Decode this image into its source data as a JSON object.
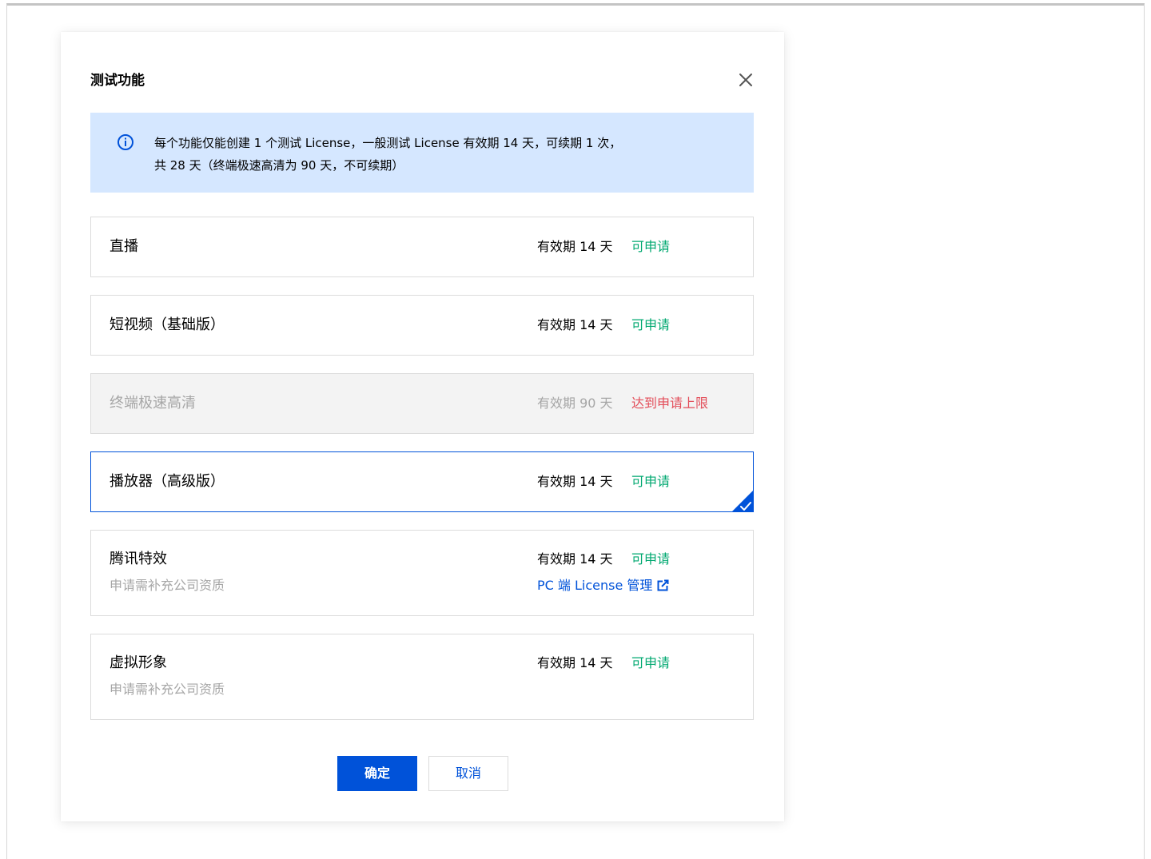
{
  "dialog": {
    "title": "测试功能",
    "close_icon": "close-icon",
    "notice": {
      "icon": "info-circle-icon",
      "line1": "每个功能仅能创建 1 个测试 License，一般测试 License 有效期 14 天，可续期 1 次，",
      "line2": "共 28 天（终端极速高清为 90 天，不可续期）"
    },
    "features": [
      {
        "name": "直播",
        "validity": "有效期 14 天",
        "status": "可申请"
      },
      {
        "name": "短视频（基础版）",
        "validity": "有效期 14 天",
        "status": "可申请"
      },
      {
        "name": "终端极速高清",
        "validity": "有效期 90 天",
        "status": "达到申请上限",
        "disabled": true
      },
      {
        "name": "播放器（高级版）",
        "validity": "有效期 14 天",
        "status": "可申请",
        "selected": true
      },
      {
        "name": "腾讯特效",
        "subtitle": "申请需补充公司资质",
        "validity": "有效期 14 天",
        "status": "可申请",
        "link": "PC 端 License 管理"
      },
      {
        "name": "虚拟形象",
        "subtitle": "申请需补充公司资质",
        "validity": "有效期 14 天",
        "status": "可申请"
      }
    ],
    "buttons": {
      "ok": "确定",
      "cancel": "取消"
    }
  },
  "colors": {
    "primary": "#0052d9",
    "success": "#00a870",
    "error": "#e34d59",
    "notice_bg": "#d5e7ff",
    "disabled_bg": "#f3f3f3"
  }
}
